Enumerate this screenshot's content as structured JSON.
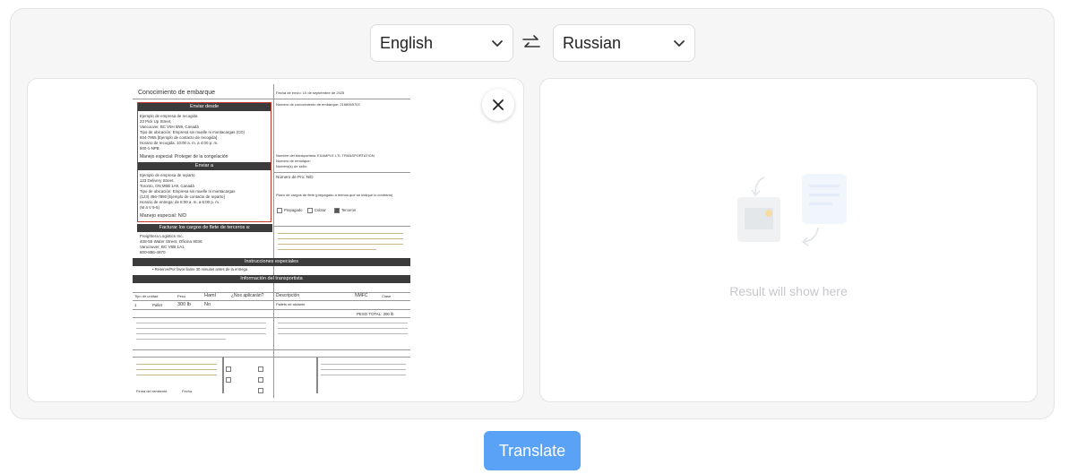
{
  "source_language": {
    "selected": "English"
  },
  "target_language": {
    "selected": "Russian"
  },
  "result": {
    "placeholder": "Result will show here"
  },
  "actions": {
    "translate_label": "Translate"
  },
  "document": {
    "title": "Conocimiento de embarque",
    "date": "Fecha de envío: 10 de septiembre de 2025",
    "bol_number": "Número de conocimiento de embarque: 2168965703",
    "ship_from_header": "Enviar desde",
    "ship_from_lines": [
      "Ejemplo de empresa de recogida",
      "23 Pick Up Street,",
      "Vancouver, BC V5H 5N9, Canadá",
      "Tipo de ubicación: Empresa sin muelle ni montacargas (CD)",
      "604-7865 [Ejemplo de contacto de recogida]",
      "Horario de recogida: 10:00 a. m. a 4:00 p. m.",
      "800-1-NPB"
    ],
    "ship_from_special": "Manejo especial: Proteger de la congelación",
    "ship_to_header": "Enviar a",
    "ship_to_lines": [
      "Ejemplo de empresa de reparto",
      "123 Delivery Street,",
      "Toronto, ON M5B 1A9, Canadá",
      "Tipo de ubicación: Empresa sin muelle ni montacargas",
      "(123) 456-7890 [Ejemplo de contacto de reparto]",
      "Horario de entrega: de 8:00 a. m. a 6:00 p. m.",
      "(M a V 9-5)"
    ],
    "ship_to_special": "Manejo especial: N/D",
    "freight_header": "Facturar los cargos de flete de terceros a:",
    "freight_lines": [
      "Freightera Logistics Inc.",
      "408-55 Water Street, Oficina 8036",
      "Vancouver, BC V6B 1A1",
      "800-886-4870"
    ],
    "special_header": "Instrucciones especiales",
    "special_line": "• Reserve/Por favor llame 30 minutos antes de la entrega",
    "carrier_header": "Información del transportista",
    "carrier_cols": [
      "Tipo de unidad",
      "Peso",
      "Haml",
      "¿Nos aplicarán?",
      "Descripción",
      "NMFC",
      "Clase"
    ],
    "carrier_row": [
      "1",
      "Pallet",
      "300 lb",
      "No",
      "Pallets de aislante"
    ],
    "total_weight": "PESO TOTAL: 300 lb",
    "right_col": [
      "Nombre del transportista: EXAMPLE LTL TRANSPORTATION",
      "Número de remolque:",
      "Número(s) de sello:",
      "Número de Pro: N/D",
      "Plazo de cargos de flete (prepagado a menos que se indique lo contrario)"
    ],
    "charge_options": [
      "Prepagado",
      "Cobrar",
      "Terceros"
    ],
    "signature_label": "Firma del remitente",
    "date_label": "Fecha"
  }
}
